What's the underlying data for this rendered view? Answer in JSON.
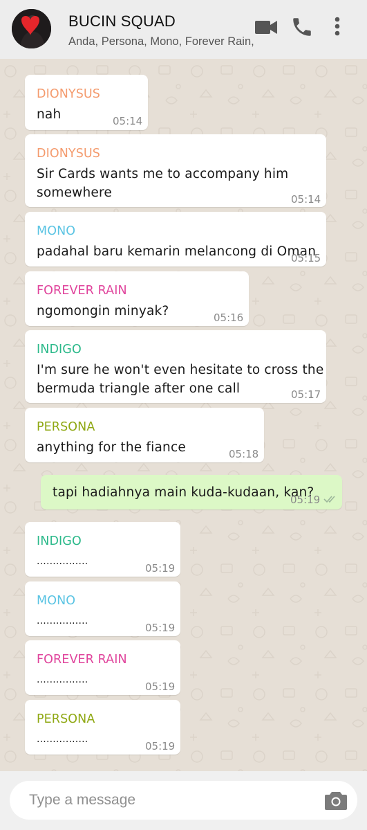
{
  "header": {
    "title": "BUCIN SQUAD",
    "members": "Anda, Persona, Mono, Forever Rain,",
    "icons": [
      "video-call-icon",
      "phone-icon",
      "more-vert-icon"
    ]
  },
  "colors": {
    "DIONYSUS": "#f49b6e",
    "MONO": "#5bc4e3",
    "FOREVER RAIN": "#e0449c",
    "INDIGO": "#2bb98a",
    "PERSONA": "#8fa813",
    "outgoing_bubble": "#dcf8c6"
  },
  "messages": [
    {
      "sender": "DIONYSUS",
      "text": "nah",
      "time": "05:14"
    },
    {
      "sender": "DIONYSUS",
      "text": "Sir Cards wants me to accompany him",
      "text2": "somewhere",
      "time": "05:14"
    },
    {
      "sender": "MONO",
      "text": "padahal baru kemarin melancong di Oman",
      "time": "05:15"
    },
    {
      "sender": "FOREVER RAIN",
      "text": "ngomongin minyak?",
      "time": "05:16"
    },
    {
      "sender": "INDIGO",
      "text": "I'm sure he won't even hesitate to cross the",
      "text2": "bermuda triangle after one call",
      "time": "05:17"
    },
    {
      "sender": "PERSONA",
      "text": "anything for the fiance",
      "time": "05:18"
    },
    {
      "sender": "Anda",
      "text": "tapi hadiahnya main kuda-kudaan, kan?",
      "time": "05:19",
      "outgoing": true,
      "status": "read-double-check-icon"
    },
    {
      "sender": "INDIGO",
      "text": "................",
      "time": "05:19"
    },
    {
      "sender": "MONO",
      "text": "................",
      "time": "05:19"
    },
    {
      "sender": "FOREVER RAIN",
      "text": "................",
      "time": "05:19"
    },
    {
      "sender": "PERSONA",
      "text": "................",
      "time": "05:19"
    }
  ],
  "footer": {
    "placeholder": "Type a message",
    "icons": [
      "camera-icon"
    ]
  }
}
